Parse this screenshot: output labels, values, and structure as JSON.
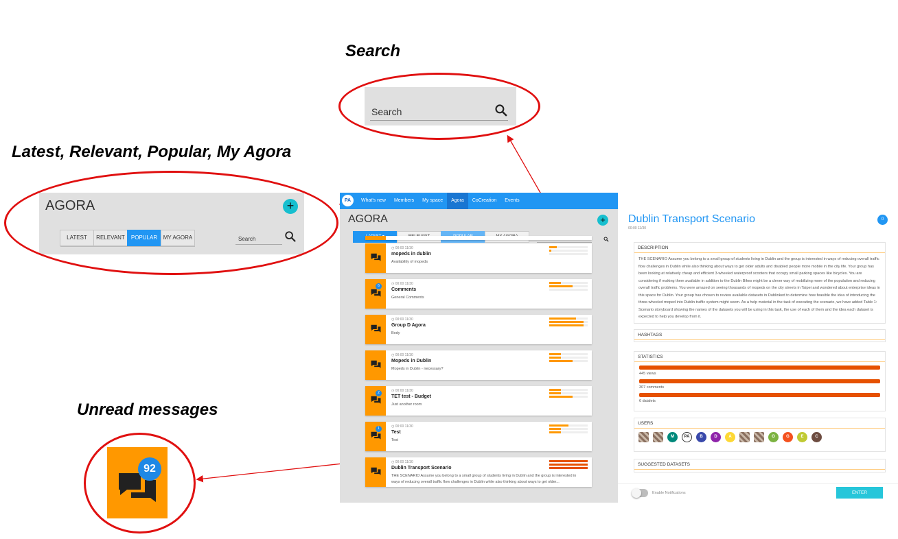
{
  "callouts": {
    "search": {
      "title": "Search",
      "field_label": "Search",
      "icon": "search-icon"
    },
    "agora": {
      "title": "Latest, Relevant, Popular, My Agora",
      "heading": "AGORA",
      "tabs": [
        "LATEST",
        "RELEVANT",
        "POPULAR",
        "MY AGORA"
      ],
      "active_tab": "POPULAR",
      "search_label": "Search"
    },
    "unread": {
      "title": "Unread messages",
      "badge": "92",
      "icon": "chat-icon"
    }
  },
  "colors": {
    "nav": "#2196f3",
    "accent": "#ff9800",
    "dark_bar": "#e65100",
    "badge": "#1e88e5",
    "teal": "#17bfcf",
    "callout": "#e01010"
  },
  "nav": {
    "logo": "PA",
    "items": [
      "What's new",
      "Members",
      "My space",
      "Agora",
      "CoCreation",
      "Events"
    ],
    "active": "Agora",
    "right_icons": [
      "mail-icon",
      "bell-icon",
      "user-icon",
      "user-icon",
      "help-icon"
    ],
    "help": "?"
  },
  "agora": {
    "heading": "AGORA",
    "tabs": {
      "latest": "LATEST",
      "relevant": "RELEVANT",
      "popular": "POPULAR",
      "my_agora": "MY AGORA"
    },
    "search_label": "Search",
    "rooms": [
      {
        "meta": "00:00 11/30",
        "name": "mopeds in dublin",
        "desc": "Availability of mopeds",
        "badge": "",
        "bars": [
          0.2,
          0.05,
          0.0
        ]
      },
      {
        "meta": "00:00 11/30",
        "name": "Comments",
        "desc": "General Comments",
        "badge": "6",
        "bars": [
          0.3,
          0.6,
          0.0
        ]
      },
      {
        "meta": "00:00 11/30",
        "name": "Group D Agora",
        "desc": "Body",
        "badge": "",
        "bars": [
          0.7,
          0.9,
          0.9
        ]
      },
      {
        "meta": "00:00 11/30",
        "name": "Mopeds in Dublin",
        "desc": "Mopeds in Dublin - necessary?",
        "badge": "",
        "bars": [
          0.3,
          0.3,
          0.6
        ]
      },
      {
        "meta": "00:00 11/30",
        "name": "TET test - Budget",
        "desc": "Just another room",
        "badge": "2",
        "bars": [
          0.3,
          0.3,
          0.6
        ]
      },
      {
        "meta": "00:00 11/30",
        "name": "Test",
        "desc": "Test",
        "badge": "1",
        "bars": [
          0.5,
          0.3,
          0.3
        ]
      },
      {
        "meta": "00:00 11/30",
        "name": "Dublin Transport Scenario",
        "desc": "THE SCENARIO Assume you belong to a small group of students living in Dublin and the group is interested in ways of reducing overall traffic flow challenges in Dublin while also thinking about ways to get older...",
        "badge": "",
        "bars": [
          1.0,
          1.0,
          1.0
        ]
      }
    ]
  },
  "detail": {
    "title": "Dublin Transport Scenario",
    "date": "00:00 11/30",
    "count": "0",
    "description_header": "DESCRIPTION",
    "description": "THE SCENARIO Assume you belong to a small group of students living in Dublin and the group is interested in ways of reducing overall traffic flow challenges in Dublin while also thinking about ways to get older adults and disabled people more mobile in the city life. Your group has been looking at relatively cheap and efficient 3-wheeled waterproof scooters that occupy small parking spaces like bicycles. You are considering if making them available in addition to the Dublin Bikes might be a clever way of mobilizing more of the population and reducing overall traffic problems. You were amazed on seeing thousands of mopeds on the city streets in Taipei and wondered about enterprise ideas in this space for Dublin. Your group has chosen to review available datasets in Dublinked to determine how feasible the idea of introducing the three-wheeled moped into Dublin traffic system might seem. As a help material in the task of executing the scenario, we have added Table 1: Scenario storyboard showing the names of the datasets you will be using in this task, the use of each of them and the idea each dataset is expected to help you develop from it.",
    "hashtags_header": "HASHTAGS",
    "statistics_header": "STATISTICS",
    "stats": [
      "445 views",
      "307 comments",
      "6 datalets"
    ],
    "users_header": "USERS",
    "users": [
      {
        "label": "",
        "color": "px"
      },
      {
        "label": "",
        "color": "px"
      },
      {
        "label": "M",
        "color": "#00897b"
      },
      {
        "label": "PA",
        "color": "#ffffff"
      },
      {
        "label": "B",
        "color": "#3949ab"
      },
      {
        "label": "D",
        "color": "#8e24aa"
      },
      {
        "label": "A",
        "color": "#fdd835"
      },
      {
        "label": "",
        "color": "px"
      },
      {
        "label": "",
        "color": "px"
      },
      {
        "label": "O",
        "color": "#7cb342"
      },
      {
        "label": "G",
        "color": "#f4511e"
      },
      {
        "label": "E",
        "color": "#c0ca33"
      },
      {
        "label": "C",
        "color": "#6d4c41"
      }
    ],
    "suggested_header": "SUGGESTED DATASETS",
    "notifications_label": "Enable Notifications",
    "enter_label": "ENTER"
  }
}
